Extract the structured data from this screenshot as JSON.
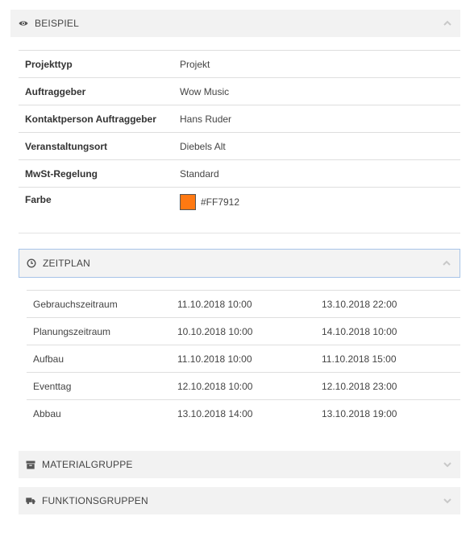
{
  "beispiel": {
    "title": "BEISPIEL",
    "icon": "eye-icon",
    "chevron": "chevron-up-icon",
    "rows": [
      {
        "label": "Projekttyp",
        "value": "Projekt"
      },
      {
        "label": "Auftraggeber",
        "value": "Wow Music"
      },
      {
        "label": "Kontaktperson Auftraggeber",
        "value": "Hans Ruder"
      },
      {
        "label": "Veranstaltungsort",
        "value": "Diebels Alt"
      },
      {
        "label": "MwSt-Regelung",
        "value": "Standard"
      }
    ],
    "color_row": {
      "label": "Farbe",
      "value": "#FF7912",
      "swatch": "#FF7912"
    }
  },
  "zeitplan": {
    "title": "ZEITPLAN",
    "icon": "clock-icon",
    "chevron": "chevron-up-icon",
    "rows": [
      {
        "name": "Gebrauchszeitraum",
        "start": "11.10.2018 10:00",
        "end": "13.10.2018 22:00"
      },
      {
        "name": "Planungszeitraum",
        "start": "10.10.2018 10:00",
        "end": "14.10.2018 10:00"
      },
      {
        "name": "Aufbau",
        "start": "11.10.2018 10:00",
        "end": "11.10.2018 15:00"
      },
      {
        "name": "Eventtag",
        "start": "12.10.2018 10:00",
        "end": "12.10.2018 23:00"
      },
      {
        "name": "Abbau",
        "start": "13.10.2018 14:00",
        "end": "13.10.2018 19:00"
      }
    ]
  },
  "materialgruppe": {
    "title": "MATERIALGRUPPE",
    "icon": "archive-icon",
    "chevron": "chevron-down-icon"
  },
  "funktionsgruppen": {
    "title": "FUNKTIONSGRUPPEN",
    "icon": "truck-icon",
    "chevron": "chevron-down-icon"
  },
  "colors": {
    "header_bg": "#f2f2f2",
    "active_border": "#a7c4e8",
    "swatch": "#FF7912"
  }
}
